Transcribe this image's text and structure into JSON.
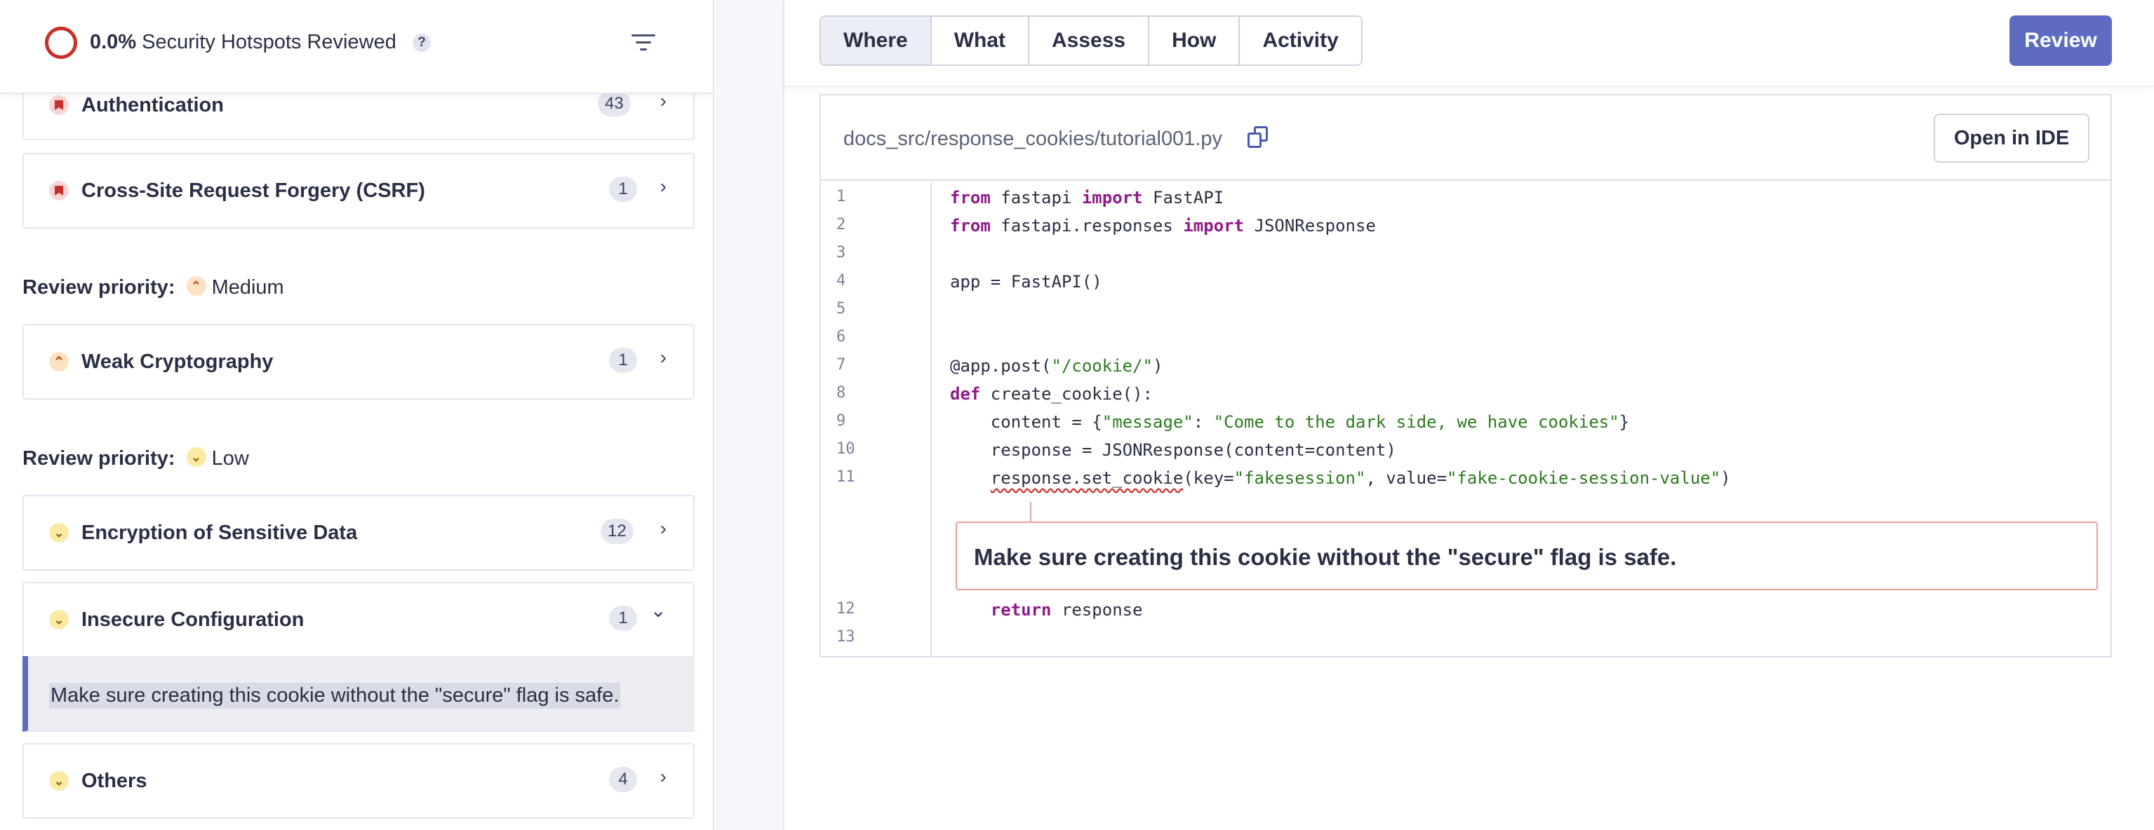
{
  "sidebar": {
    "header": {
      "percent": "0.0%",
      "title": "Security Hotspots Reviewed",
      "help": "?"
    },
    "categories": [
      {
        "name": "Authentication",
        "count": "43",
        "chevron": "›"
      },
      {
        "name": "Cross-Site Request Forgery (CSRF)",
        "count": "1",
        "chevron": "›"
      },
      {
        "name": "Weak Cryptography",
        "count": "1",
        "chevron": "›"
      },
      {
        "name": "Encryption of Sensitive Data",
        "count": "12",
        "chevron": "›"
      },
      {
        "name": "Insecure Configuration",
        "count": "1",
        "chevron": "⌄"
      },
      {
        "name": "Others",
        "count": "4",
        "chevron": "›"
      }
    ],
    "priority_medium": {
      "label": "Review priority:",
      "value": "Medium",
      "icon": "⌃"
    },
    "priority_low": {
      "label": "Review priority:",
      "value": "Low",
      "icon": "⌄"
    },
    "selected_hotspot": "Make sure creating this cookie without the \"secure\" flag is safe."
  },
  "main": {
    "tabs": [
      {
        "label": "Where",
        "active": true
      },
      {
        "label": "What",
        "active": false
      },
      {
        "label": "Assess",
        "active": false
      },
      {
        "label": "How",
        "active": false
      },
      {
        "label": "Activity",
        "active": false
      }
    ],
    "review_button": "Review",
    "file_path": "docs_src/response_cookies/tutorial001.py",
    "open_in_ide": "Open in IDE",
    "code_lines": [
      {
        "n": "1",
        "text": "from fastapi import FastAPI"
      },
      {
        "n": "2",
        "text": "from fastapi.responses import JSONResponse"
      },
      {
        "n": "3",
        "text": ""
      },
      {
        "n": "4",
        "text": "app = FastAPI()"
      },
      {
        "n": "5",
        "text": ""
      },
      {
        "n": "6",
        "text": ""
      },
      {
        "n": "7",
        "text": "@app.post(\"/cookie/\")"
      },
      {
        "n": "8",
        "text": "def create_cookie():"
      },
      {
        "n": "9",
        "text": "    content = {\"message\": \"Come to the dark side, we have cookies\"}"
      },
      {
        "n": "10",
        "text": "    response = JSONResponse(content=content)"
      },
      {
        "n": "11",
        "text": "    response.set_cookie(key=\"fakesession\", value=\"fake-cookie-session-value\")"
      },
      {
        "n": "12",
        "text": "    return response"
      },
      {
        "n": "13",
        "text": ""
      }
    ],
    "issue_message": "Make sure creating this cookie without the \"secure\" flag is safe."
  },
  "colors": {
    "accent": "#5d6cc0",
    "high_priority": "#c8302c",
    "keyword": "#8f1a8a",
    "string": "#2d7a1f"
  },
  "icons": [
    "progress-ring-icon",
    "help-icon",
    "filter-icon",
    "copy-icon",
    "chevron-right-icon",
    "chevron-down-icon",
    "priority-high-icon",
    "priority-medium-icon",
    "priority-low-icon"
  ]
}
